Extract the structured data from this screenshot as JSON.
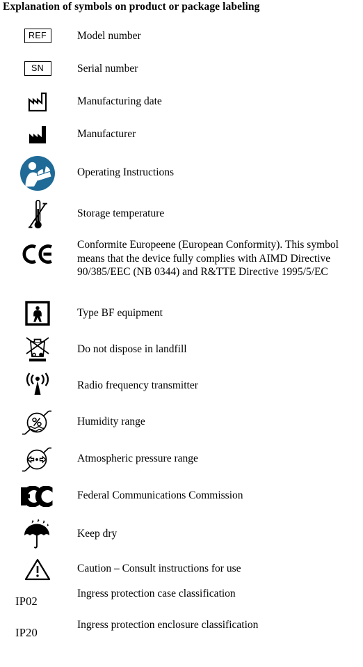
{
  "document": {
    "title": "Explanation of symbols on product or package labeling"
  },
  "colors": {
    "text": "#000000",
    "background": "#ffffff",
    "operating_instructions_blue": "#1F6A97"
  },
  "legend": {
    "rows": [
      {
        "symbol_kind": "boxed-text",
        "symbol_name": "ref-symbol",
        "symbol_text": "REF",
        "description": "Model number"
      },
      {
        "symbol_kind": "boxed-text",
        "symbol_name": "sn-symbol",
        "symbol_text": "SN",
        "description": "Serial number"
      },
      {
        "symbol_kind": "svg",
        "symbol_name": "manufacturing-date-icon",
        "symbol_text": "",
        "description": "Manufacturing date"
      },
      {
        "symbol_kind": "svg",
        "symbol_name": "manufacturer-icon",
        "symbol_text": "",
        "description": "Manufacturer"
      },
      {
        "symbol_kind": "svg",
        "symbol_name": "operating-instructions-icon",
        "symbol_text": "",
        "description": "Operating Instructions"
      },
      {
        "symbol_kind": "svg",
        "symbol_name": "storage-temperature-icon",
        "symbol_text": "",
        "description": "Storage temperature"
      },
      {
        "symbol_kind": "svg",
        "symbol_name": "ce-mark-icon",
        "symbol_text": "",
        "description": "Conformite Europeene (European Conformity). This symbol means that the device fully complies with AIMD Directive 90/385/EEC (NB 0344) and R&TTE Directive 1995/5/EC"
      },
      {
        "symbol_kind": "svg",
        "symbol_name": "type-bf-equipment-icon",
        "symbol_text": "",
        "description": "Type BF equipment"
      },
      {
        "symbol_kind": "svg",
        "symbol_name": "do-not-dispose-landfill-icon",
        "symbol_text": "",
        "description": "Do not dispose in landfill"
      },
      {
        "symbol_kind": "svg",
        "symbol_name": "radio-frequency-transmitter-icon",
        "symbol_text": "",
        "description": "Radio frequency transmitter"
      },
      {
        "symbol_kind": "svg",
        "symbol_name": "humidity-range-icon",
        "symbol_text": "",
        "description": "Humidity range"
      },
      {
        "symbol_kind": "svg",
        "symbol_name": "atmospheric-pressure-range-icon",
        "symbol_text": "",
        "description": "Atmospheric pressure range"
      },
      {
        "symbol_kind": "svg",
        "symbol_name": "fcc-logo-icon",
        "symbol_text": "",
        "description": "Federal Communications Commission"
      },
      {
        "symbol_kind": "svg",
        "symbol_name": "keep-dry-icon",
        "symbol_text": "",
        "description": "Keep dry"
      },
      {
        "symbol_kind": "svg",
        "symbol_name": "caution-triangle-icon",
        "symbol_text": "",
        "description": "Caution – Consult instructions for use"
      },
      {
        "symbol_kind": "plain-text",
        "symbol_name": "ip02-symbol",
        "symbol_text": "IP02",
        "description": "Ingress protection case classification"
      },
      {
        "symbol_kind": "plain-text",
        "symbol_name": "ip20-symbol",
        "symbol_text": "IP20",
        "description": "Ingress protection enclosure classification"
      }
    ]
  }
}
